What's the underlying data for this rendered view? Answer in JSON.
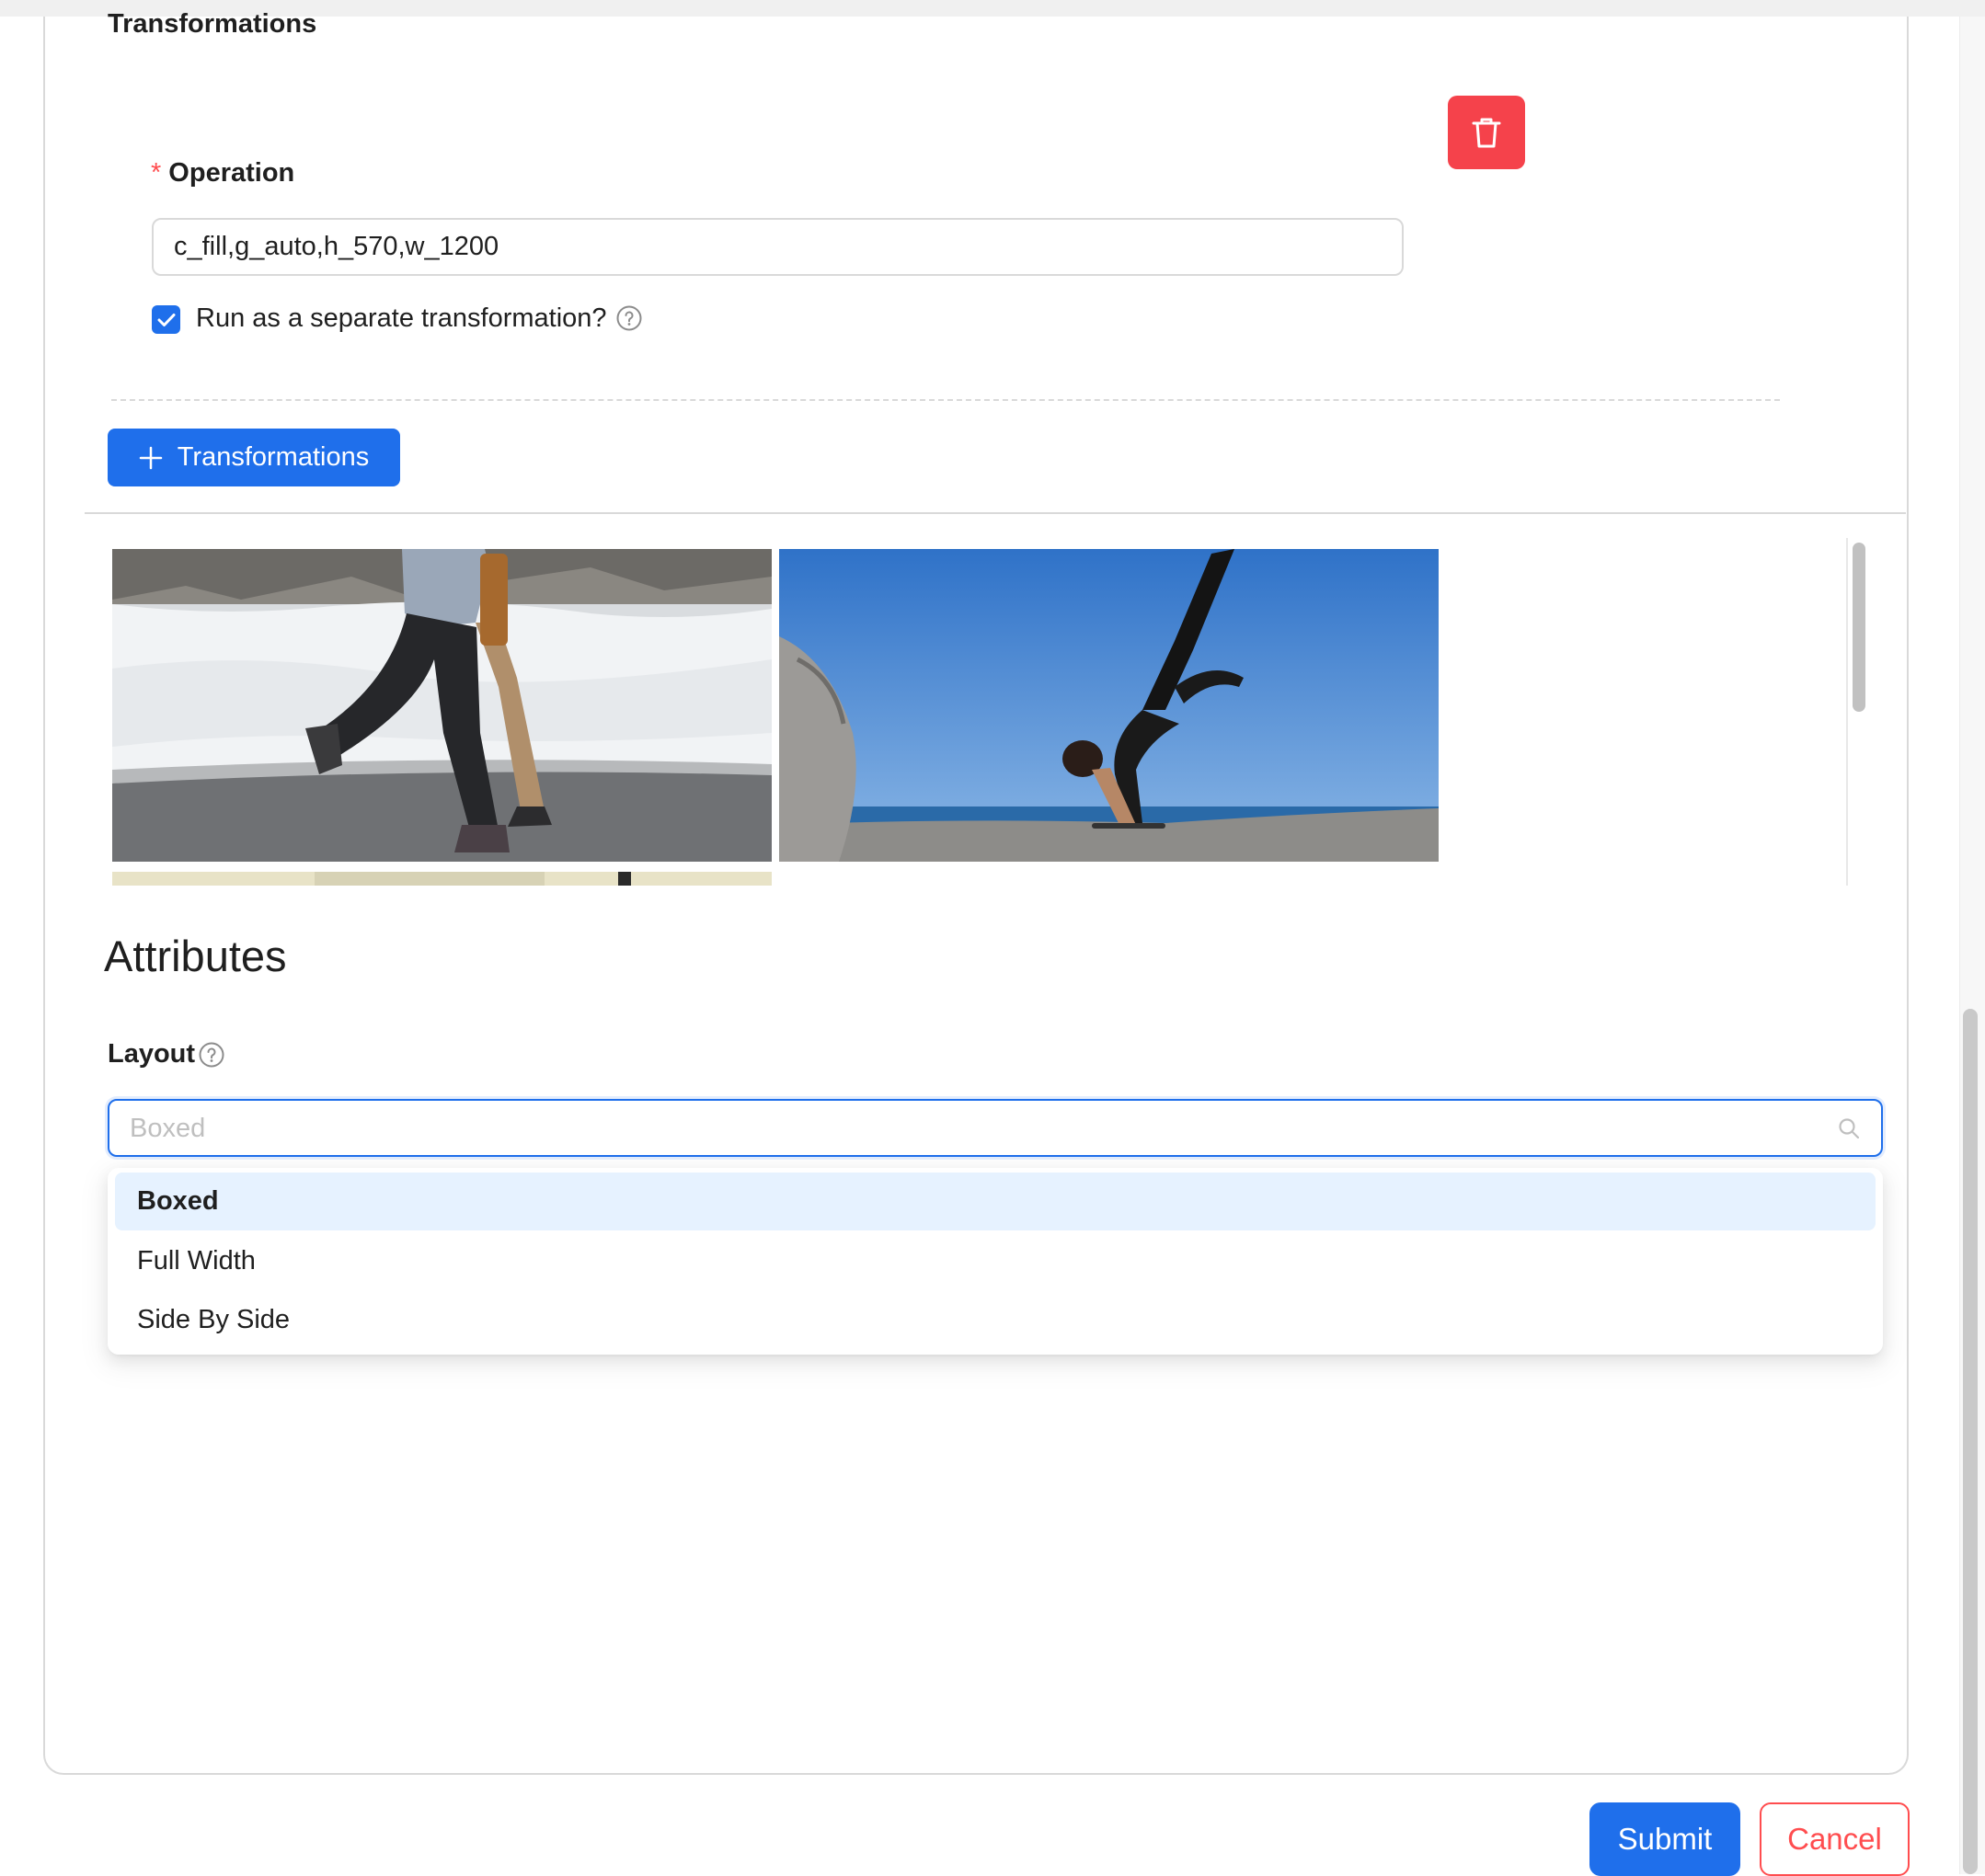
{
  "transformations": {
    "section_label": "Transformations",
    "operation": {
      "required_mark": "*",
      "label": "Operation",
      "value": "c_fill,g_auto,h_570,w_1200"
    },
    "separate": {
      "checked": true,
      "label": "Run as a separate transformation?"
    },
    "add_button_label": "Transformations",
    "delete_icon": "trash-icon"
  },
  "gallery": {
    "images": [
      {
        "name": "runners-in-snow",
        "description_visible": false
      },
      {
        "name": "yoga-crow-pose-by-sea",
        "description_visible": false
      }
    ]
  },
  "attributes": {
    "heading": "Attributes",
    "layout": {
      "label": "Layout",
      "placeholder": "Boxed",
      "options": [
        "Boxed",
        "Full Width",
        "Side By Side"
      ],
      "selected": "Boxed"
    }
  },
  "footer": {
    "submit_label": "Submit",
    "cancel_label": "Cancel"
  },
  "colors": {
    "primary": "#1f6feb",
    "danger": "#ff4d4f",
    "delete_button": "#f5424b",
    "selected_option_bg": "#e6f2ff"
  }
}
